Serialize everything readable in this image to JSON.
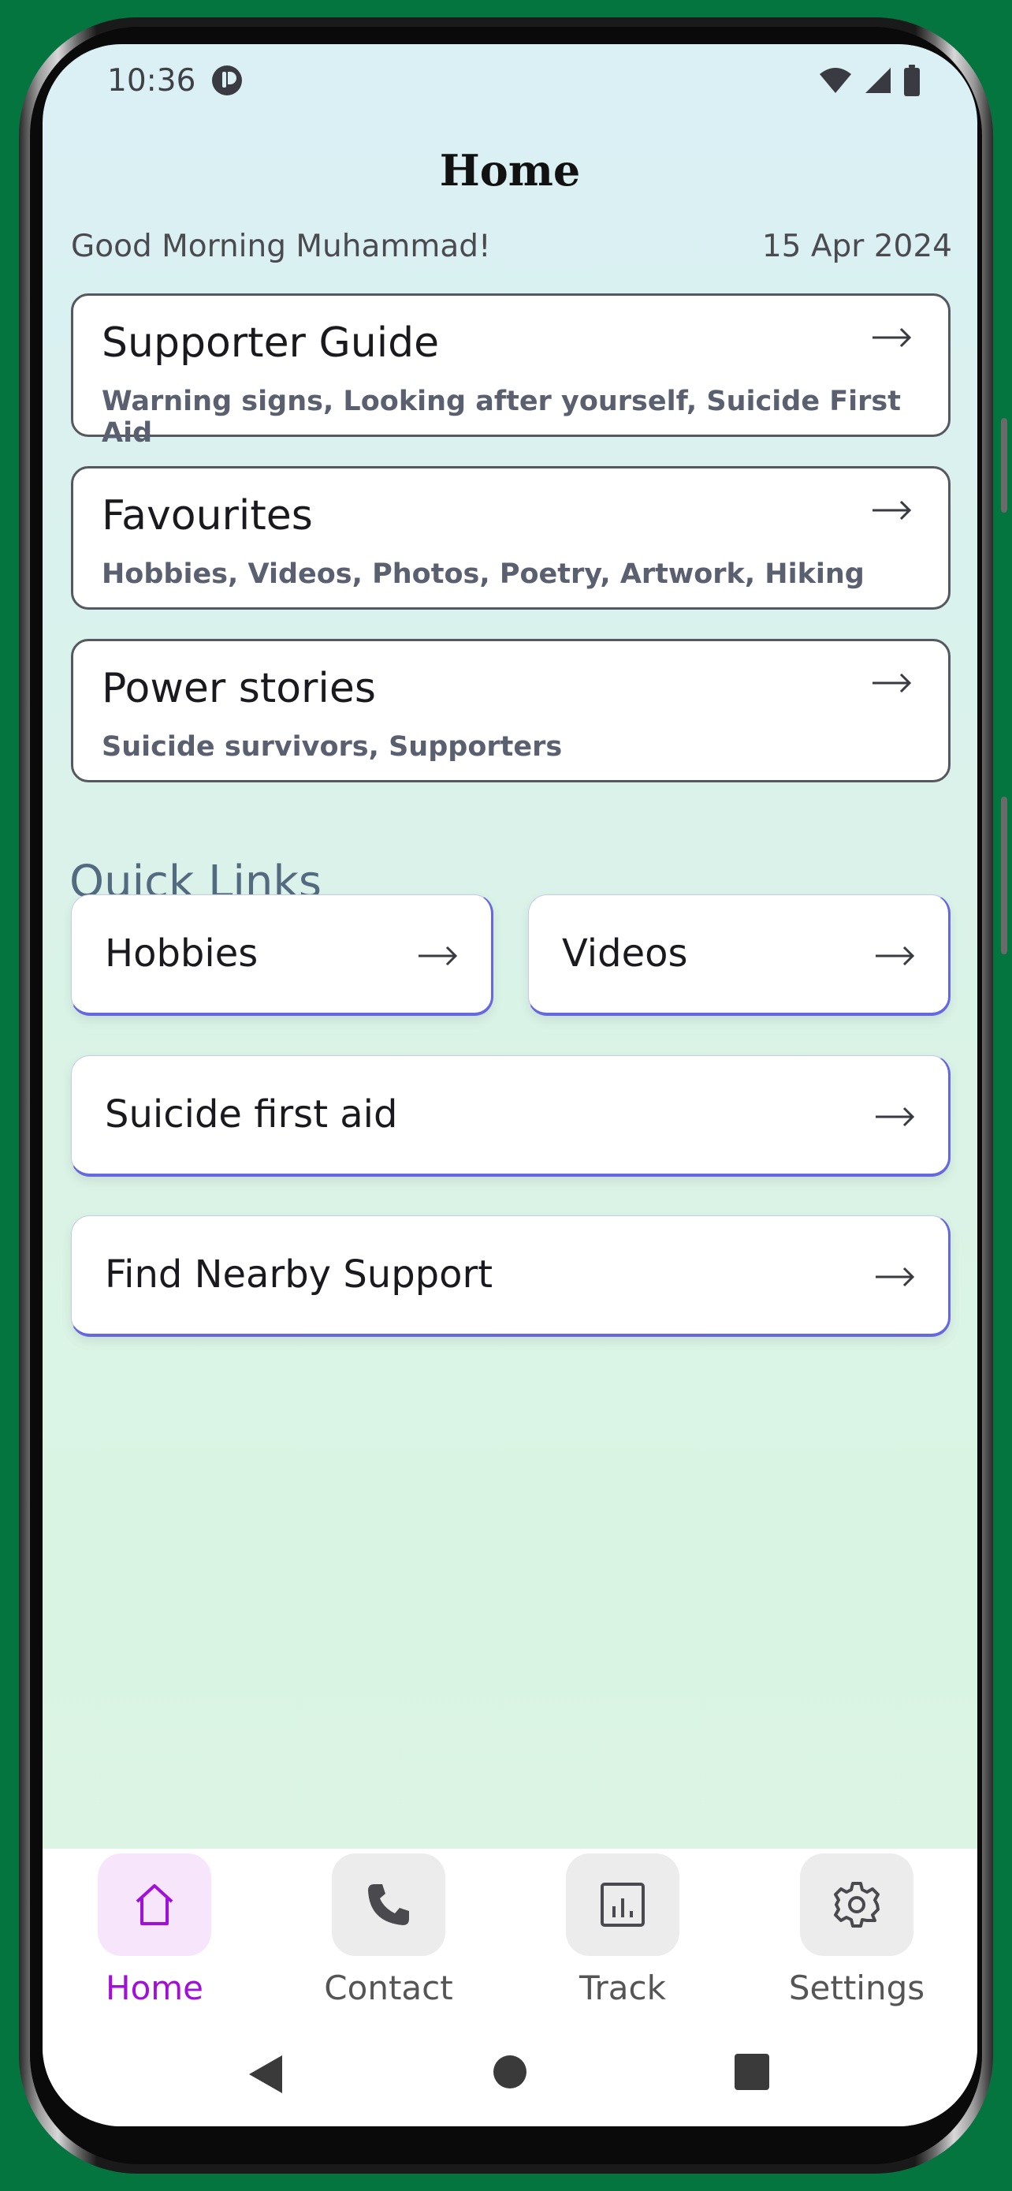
{
  "status_bar": {
    "time": "10:36",
    "app_icon": "app-indicator-icon",
    "icons": [
      "wifi-icon",
      "signal-icon",
      "battery-icon"
    ]
  },
  "header": {
    "title": "Home",
    "greeting": "Good Morning Muhammad!",
    "date": "15 Apr 2024"
  },
  "cards": [
    {
      "title": "Supporter Guide",
      "subtitle": "Warning signs, Looking after yourself, Suicide First Aid"
    },
    {
      "title": "Favourites",
      "subtitle": "Hobbies, Videos, Photos, Poetry, Artwork, Hiking"
    },
    {
      "title": "Power stories",
      "subtitle": "Suicide survivors, Supporters"
    }
  ],
  "quick_links": {
    "title": "Quick Links",
    "items": [
      {
        "label": "Hobbies"
      },
      {
        "label": "Videos"
      },
      {
        "label": "Suicide first aid"
      },
      {
        "label": "Find Nearby Support"
      }
    ]
  },
  "bottom_nav": {
    "items": [
      {
        "label": "Home",
        "icon": "home-icon",
        "active": true
      },
      {
        "label": "Contact",
        "icon": "phone-icon",
        "active": false
      },
      {
        "label": "Track",
        "icon": "chart-icon",
        "active": false
      },
      {
        "label": "Settings",
        "icon": "gear-icon",
        "active": false
      }
    ]
  },
  "system_nav": {
    "buttons": [
      "back-icon",
      "home-circle-icon",
      "recents-icon"
    ]
  },
  "colors": {
    "accent": "#a010d8",
    "link_border": "#6568e0",
    "background": "#04753f"
  }
}
